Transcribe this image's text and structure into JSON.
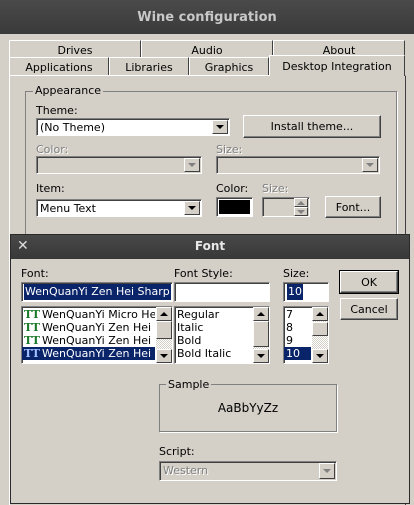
{
  "window": {
    "title": "Wine configuration"
  },
  "tabs_row1": [
    "Drives",
    "Audio",
    "About"
  ],
  "tabs_row2": [
    "Applications",
    "Libraries",
    "Graphics",
    "Desktop Integration"
  ],
  "appearance": {
    "group_label": "Appearance",
    "theme_label": "Theme:",
    "theme_value": "(No Theme)",
    "install_button": "Install theme...",
    "color_label": "Color:",
    "size_label": "Size:",
    "item_label": "Item:",
    "item_value": "Menu Text",
    "item_color_label": "Color:",
    "item_size_label": "Size:",
    "item_color": "#000000",
    "font_button": "Font..."
  },
  "font_dialog": {
    "title": "Font",
    "close_glyph": "✕",
    "font_label": "Font:",
    "font_value": "WenQuanYi Zen Hei Sharp",
    "font_items": [
      {
        "icon": "TT",
        "name": "WenQuanYi Micro Hei"
      },
      {
        "icon": "TT",
        "name": "WenQuanYi Zen Hei"
      },
      {
        "icon": "TT",
        "name": "WenQuanYi Zen Hei"
      },
      {
        "icon": "TT",
        "name": "WenQuanYi Zen Hei"
      }
    ],
    "style_label": "Font Style:",
    "style_value": "",
    "style_items": [
      "Regular",
      "Italic",
      "Bold",
      "Bold Italic"
    ],
    "size_label": "Size:",
    "size_value": "10",
    "size_items": [
      "7",
      "8",
      "9",
      "10"
    ],
    "ok_button": "OK",
    "cancel_button": "Cancel",
    "sample_label": "Sample",
    "sample_text": "AaBbYyZz",
    "script_label": "Script:",
    "script_value": "Western"
  }
}
